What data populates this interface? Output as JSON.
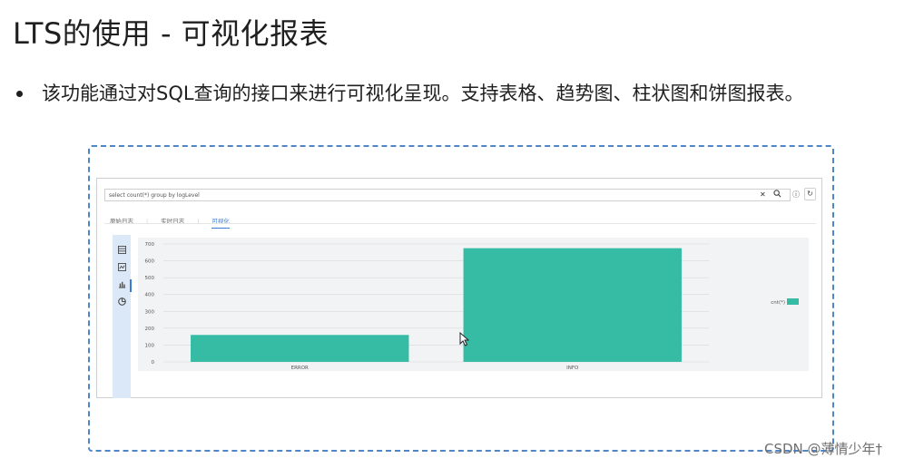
{
  "slide": {
    "title": "LTS的使用 - 可视化报表",
    "bullet": "该功能通过对SQL查询的接口来进行可视化呈现。支持表格、趋势图、柱状图和饼图报表。"
  },
  "console": {
    "query_value": "select count(*) group by logLevel",
    "clear_icon": "close-icon",
    "search_icon": "search-icon",
    "help_icon": "help-icon",
    "refresh_icon": "refresh-icon",
    "tabs": [
      {
        "label": "原始日志",
        "active": false
      },
      {
        "label": "实时日志",
        "active": false
      },
      {
        "label": "可视化",
        "active": true
      }
    ],
    "side_icons": [
      "table-icon",
      "trend-chart-icon",
      "bar-chart-icon",
      "pie-chart-icon"
    ],
    "active_side_icon": "bar-chart-icon",
    "accent_color": "#3a7bd5"
  },
  "chart_data": {
    "type": "bar",
    "categories": [
      "ERROR",
      "INFO"
    ],
    "series": [
      {
        "name": "cnt(*)",
        "values": [
          160,
          675
        ],
        "color": "#36bca5"
      }
    ],
    "yticks": [
      "700",
      "600",
      "500",
      "400",
      "300",
      "200",
      "100",
      "0"
    ],
    "ylim": [
      0,
      700
    ],
    "grid": true,
    "legend_position": "right"
  },
  "watermark": "CSDN @薄情少年†"
}
